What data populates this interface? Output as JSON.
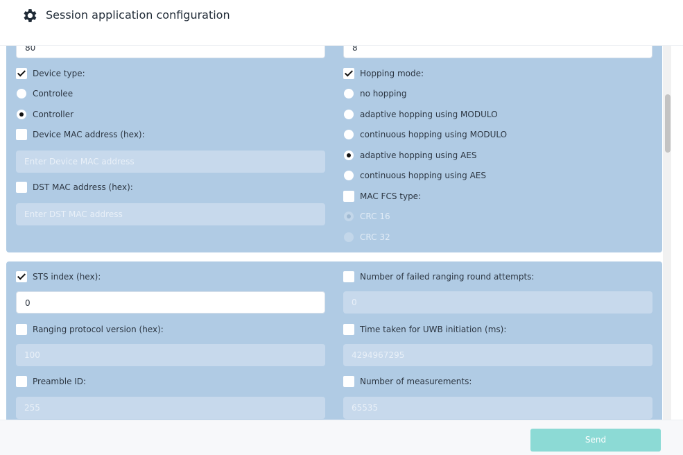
{
  "header": {
    "title": "Session application configuration",
    "icon": "gear-icon"
  },
  "panel1": {
    "left_top_value": "80",
    "right_top_value": "8",
    "device_type_label": "Device type:",
    "controlee_label": "Controlee",
    "controller_label": "Controller",
    "device_mac_label": "Device MAC address (hex):",
    "device_mac_placeholder": "Enter Device MAC address",
    "dst_mac_label": "DST MAC address (hex):",
    "dst_mac_placeholder": "Enter DST MAC address",
    "hopping_mode_label": "Hopping mode:",
    "hop_none": "no hopping",
    "hop_adaptive_modulo": "adaptive hopping using MODULO",
    "hop_continuous_modulo": "continuous hopping using MODULO",
    "hop_adaptive_aes": "adaptive hopping using AES",
    "hop_continuous_aes": "continuous hopping using AES",
    "mac_fcs_label": "MAC FCS type:",
    "crc16": "CRC 16",
    "crc32": "CRC 32"
  },
  "panel2": {
    "sts_index_label": "STS index (hex):",
    "sts_index_value": "0",
    "failed_attempts_label": "Number of failed ranging round attempts:",
    "failed_attempts_value": "0",
    "ranging_version_label": "Ranging protocol version (hex):",
    "ranging_version_value": "100",
    "uwb_init_label": "Time taken for UWB initiation (ms):",
    "uwb_init_value": "4294967295",
    "preamble_label": "Preamble ID:",
    "preamble_value": "255",
    "measurements_label": "Number of measurements:",
    "measurements_value": "65535"
  },
  "footer": {
    "send_label": "Send"
  },
  "colors": {
    "panel": "#b0cbe4",
    "send": "#8cdad5"
  }
}
